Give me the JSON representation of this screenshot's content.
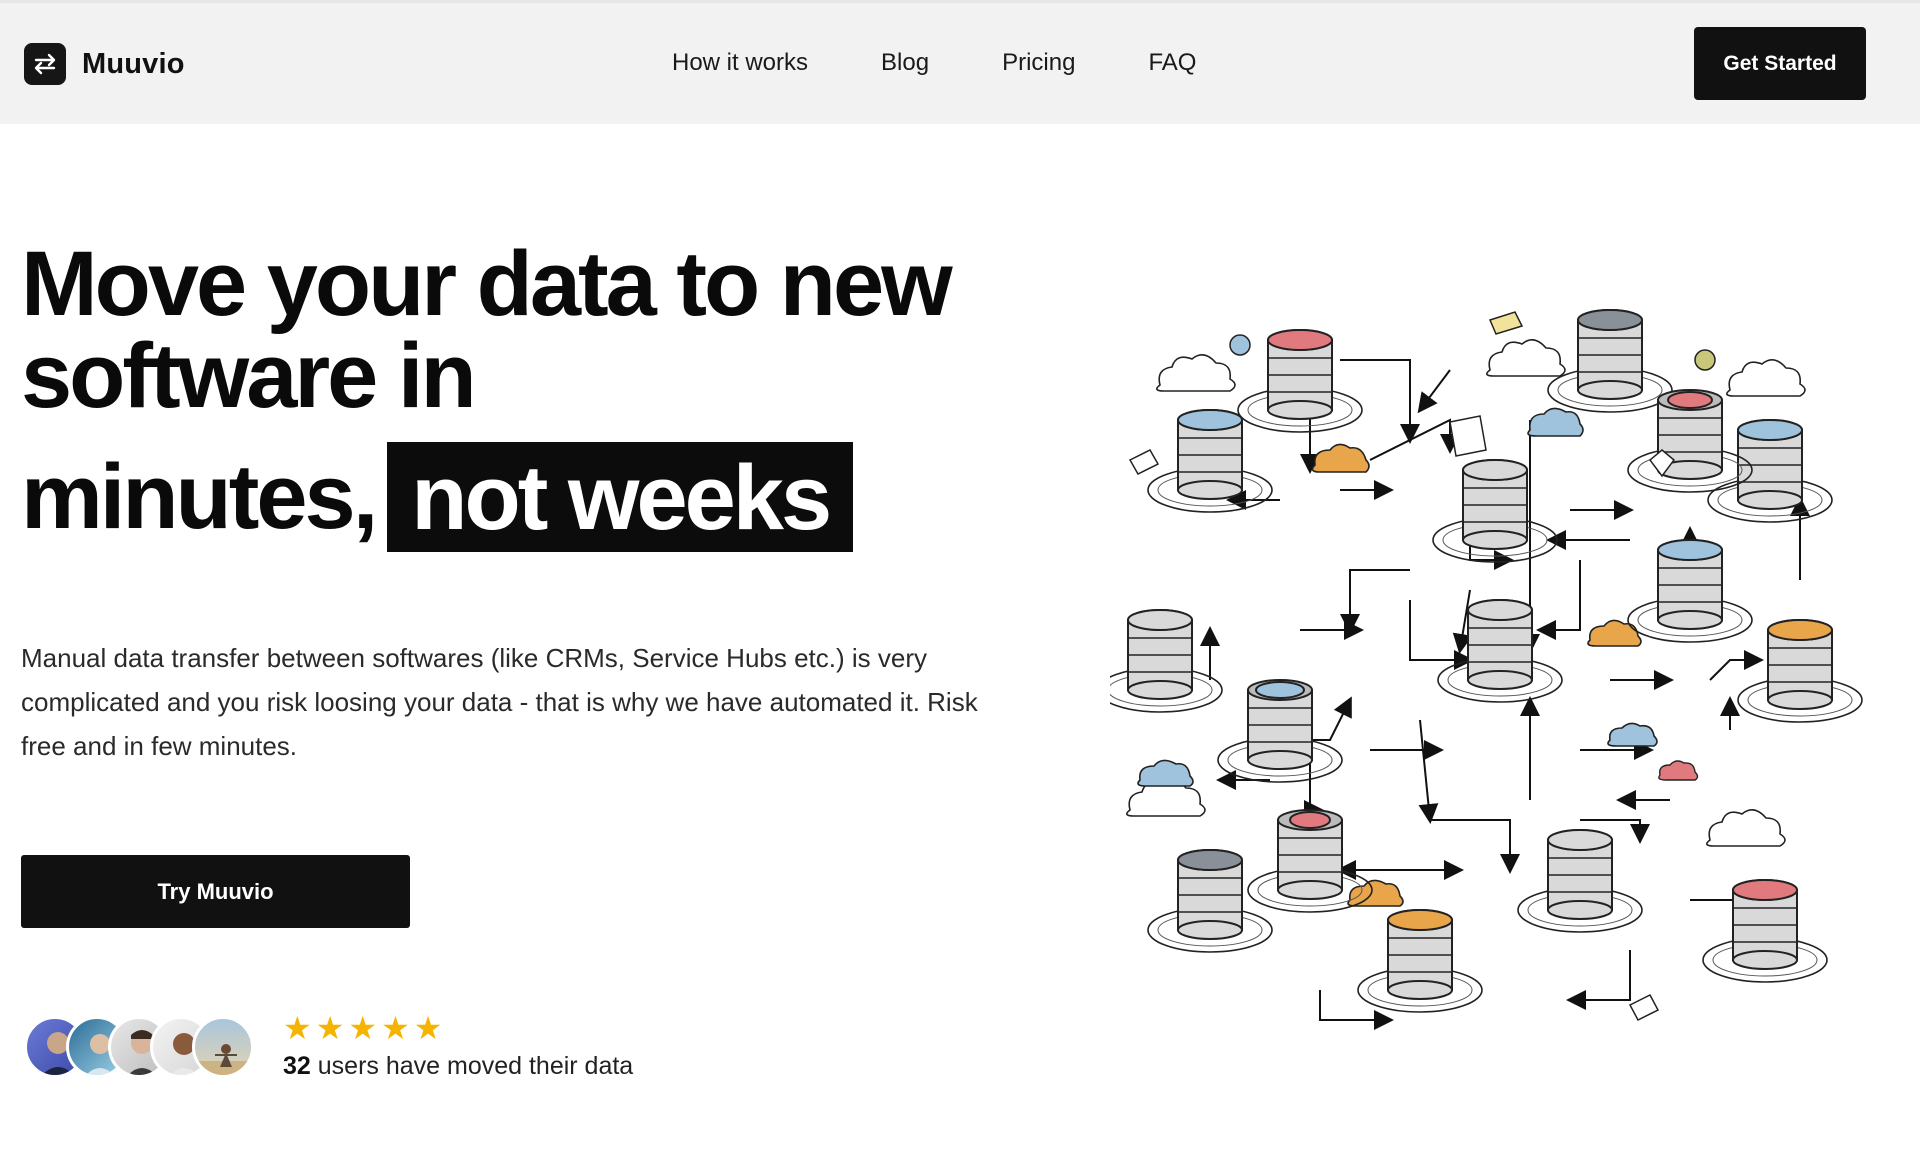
{
  "brand": {
    "name": "Muuvio",
    "logo_icon": "swap-arrows-icon"
  },
  "nav": {
    "items": [
      {
        "label": "How it works"
      },
      {
        "label": "Blog"
      },
      {
        "label": "Pricing"
      },
      {
        "label": "FAQ"
      }
    ],
    "cta_label": "Get Started"
  },
  "hero": {
    "title_line1": "Move your data to new",
    "title_line2": "software in",
    "title_line3_plain": "minutes,",
    "title_line3_highlight": "not weeks",
    "description": "Manual data transfer between softwares (like CRMs, Service Hubs etc.) is very complicated and you risk loosing your data - that is why we have automated it. Risk free and in few minutes.",
    "button_label": "Try Muuvio"
  },
  "social_proof": {
    "rating_stars": 5,
    "count": "32",
    "text": " users have moved their data",
    "avatar_count": 5
  },
  "colors": {
    "header_bg": "#f2f2f2",
    "button_bg": "#111111",
    "star": "#f5b400",
    "db_red": "#e07a7f",
    "db_blue": "#9fc3dc",
    "db_orange": "#e8a54a",
    "db_gray": "#8a9097"
  }
}
